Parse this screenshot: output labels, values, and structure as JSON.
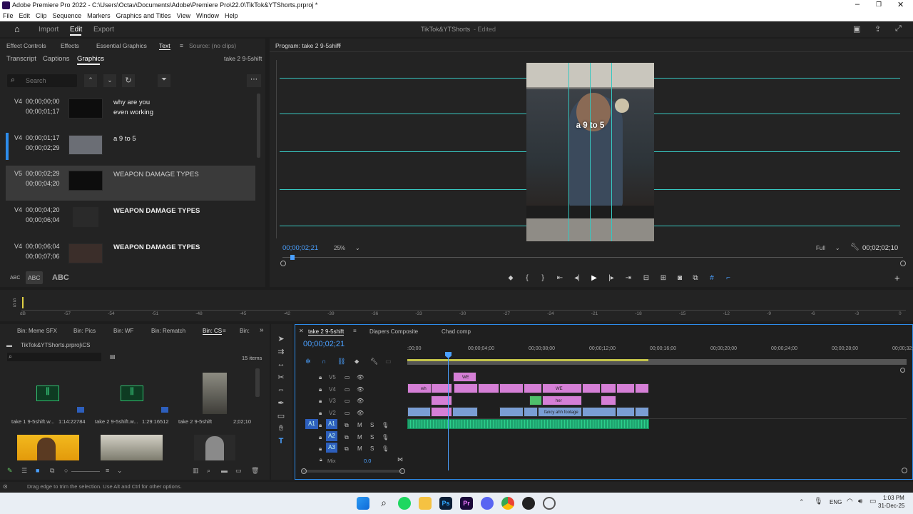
{
  "window": {
    "title": "Adobe Premiere Pro 2022 - C:\\Users\\Octav\\Documents\\Adobe\\Premiere Pro\\22.0\\TikTok&YTShorts.prproj *"
  },
  "menu": [
    "File",
    "Edit",
    "Clip",
    "Sequence",
    "Markers",
    "Graphics and Titles",
    "View",
    "Window",
    "Help"
  ],
  "workspace": {
    "tabs": [
      "Import",
      "Edit",
      "Export"
    ],
    "project_title": "TikTok&YTShorts",
    "status": "- Edited"
  },
  "left_panel": {
    "tabs": [
      "Effect Controls",
      "Effects",
      "Essential Graphics",
      "Text",
      "Source: (no clips)"
    ],
    "subtabs": [
      "Transcript",
      "Captions",
      "Graphics"
    ],
    "sequence_name": "take 2 9-5shift",
    "search_placeholder": "Search",
    "items": [
      {
        "track": "V4",
        "start": "00;00;00;00",
        "end": "00;00;01;17",
        "text": "why are you\neven working"
      },
      {
        "track": "V4",
        "start": "00;00;01;17",
        "end": "00;00;02;29",
        "text": "a 9 to 5"
      },
      {
        "track": "V5",
        "start": "00;00;02;29",
        "end": "00;00;04;20",
        "text": "WEAPON DAMAGE TYPES"
      },
      {
        "track": "V4",
        "start": "00;00;04;20",
        "end": "00;00;06;04",
        "text": "WEAPON DAMAGE TYPES"
      },
      {
        "track": "V4",
        "start": "00;00;06;04",
        "end": "00;00;07;06",
        "text": "WEAPON DAMAGE TYPES"
      }
    ],
    "abc": [
      "ABC",
      "ABC",
      "ABC"
    ]
  },
  "program": {
    "title": "Program: take 2 9-5shift",
    "overlay_text": "a 9 to 5",
    "timecode": "00;00;02;21",
    "zoom": "25%",
    "quality": "Full",
    "duration": "00;02;02;10"
  },
  "audio_meter": {
    "labels": [
      "dB",
      "-57",
      "-54",
      "-51",
      "-48",
      "-45",
      "-42",
      "-39",
      "-36",
      "-33",
      "-30",
      "-27",
      "-24",
      "-21",
      "-18",
      "-15",
      "-12",
      "-9",
      "-6",
      "-3",
      "0"
    ]
  },
  "bins": {
    "tabs": [
      "Bin: Meme SFX",
      "Bin: Pics",
      "Bin: WF",
      "Bin: Rematch",
      "Bin: CS",
      "Bin:"
    ],
    "path": "TikTok&YTShorts.prproj\\CS",
    "count": "15 items",
    "items": [
      {
        "name": "take 1 9-5shift.w...",
        "dur": "1:14:22784"
      },
      {
        "name": "take 2 9-5shift.w...",
        "dur": "1:29:16512"
      },
      {
        "name": "take 2 9-5shift",
        "dur": "2;02;10"
      }
    ]
  },
  "timeline": {
    "tabs": [
      "take 2 9-5shift",
      "Diapers Composite",
      "Chad comp"
    ],
    "timecode": "00;00;02;21",
    "ruler": [
      ":00;00",
      "00;00;04;00",
      "00;00;08;00",
      "00;00;12;00",
      "00;00;16;00",
      "00;00;20;00",
      "00;00;24;00",
      "00;00;28;00",
      "00;00;32;0"
    ],
    "tracks": [
      "V5",
      "V4",
      "V3",
      "V2",
      "A1",
      "A2",
      "A3"
    ],
    "mix_label": "Mix",
    "mix_value": "0.0",
    "clip_labels": {
      "we_top": "WE",
      "v4_a": "wh",
      "v4_we": "WE",
      "v3_her": "her",
      "v2_fancy": "fancy ahh footage"
    }
  },
  "status_bar": "Drag edge to trim the selection. Use Alt and Ctrl for other options.",
  "taskbar": {
    "lang": "ENG",
    "time": "1:03 PM",
    "date": "31-Dec-25"
  },
  "colors": {
    "accent": "#2d8ceb",
    "clip_pink": "#d57fd6",
    "clip_blue": "#7a9ed4",
    "clip_green": "#4fbf6b",
    "audio": "#1fa36f",
    "guide": "#37c6c0"
  }
}
